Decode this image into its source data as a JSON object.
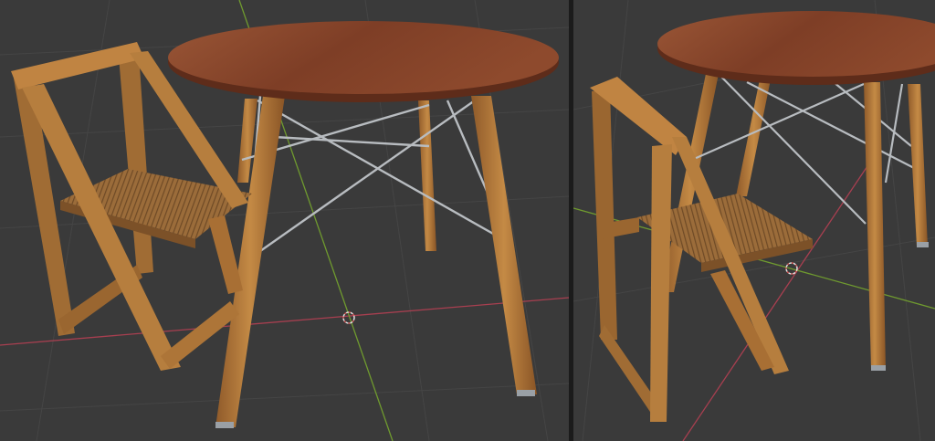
{
  "viewports": [
    {
      "id": "left",
      "view": "perspective",
      "objects": [
        "round-wooden-table",
        "folding-wooden-chair"
      ],
      "colors": {
        "background": "#3a3a3a",
        "grid": "#454545",
        "x_axis": "#a83f50",
        "y_axis": "#6f9a2f"
      }
    },
    {
      "id": "right",
      "view": "perspective",
      "objects": [
        "round-wooden-table",
        "folding-wooden-chair"
      ],
      "colors": {
        "background": "#3a3a3a",
        "grid": "#454545",
        "x_axis": "#a83f50",
        "y_axis": "#6f9a2f"
      }
    }
  ],
  "materials": {
    "table_top": "#8a4a30",
    "chair_wood": "#b07a3c",
    "metal_brace": "#b8bcc0"
  }
}
